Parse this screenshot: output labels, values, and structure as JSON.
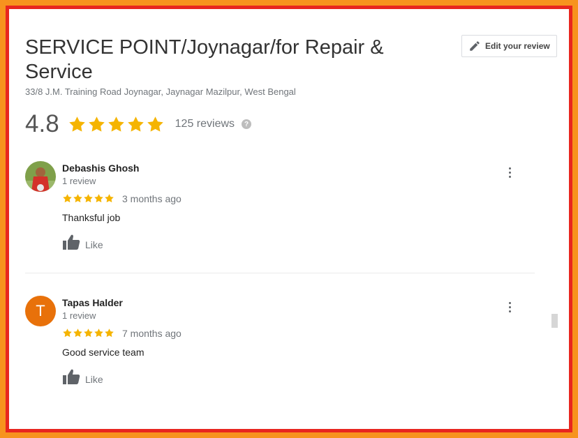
{
  "business": {
    "name": "SERVICE POINT/Joynagar/for Repair & Service",
    "address": "33/8 J.M. Training Road Joynagar, Jaynagar Mazilpur, West Bengal",
    "rating": "4.8",
    "review_count": "125 reviews",
    "help_icon": "?",
    "star_color": "#f5b400"
  },
  "edit_review_button": {
    "label": "Edit your review",
    "icon": "pencil-icon"
  },
  "reviews": [
    {
      "name": "Debashis Ghosh",
      "meta": "1 review",
      "stars": 5,
      "date": "3 months ago",
      "text": "Thanksful job",
      "like_label": "Like",
      "avatar": "photo"
    },
    {
      "name": "Tapas Halder",
      "meta": "1 review",
      "stars": 5,
      "date": "7 months ago",
      "text": "Good service team",
      "like_label": "Like",
      "avatar_letter": "T",
      "avatar_color": "#e8710a"
    }
  ]
}
